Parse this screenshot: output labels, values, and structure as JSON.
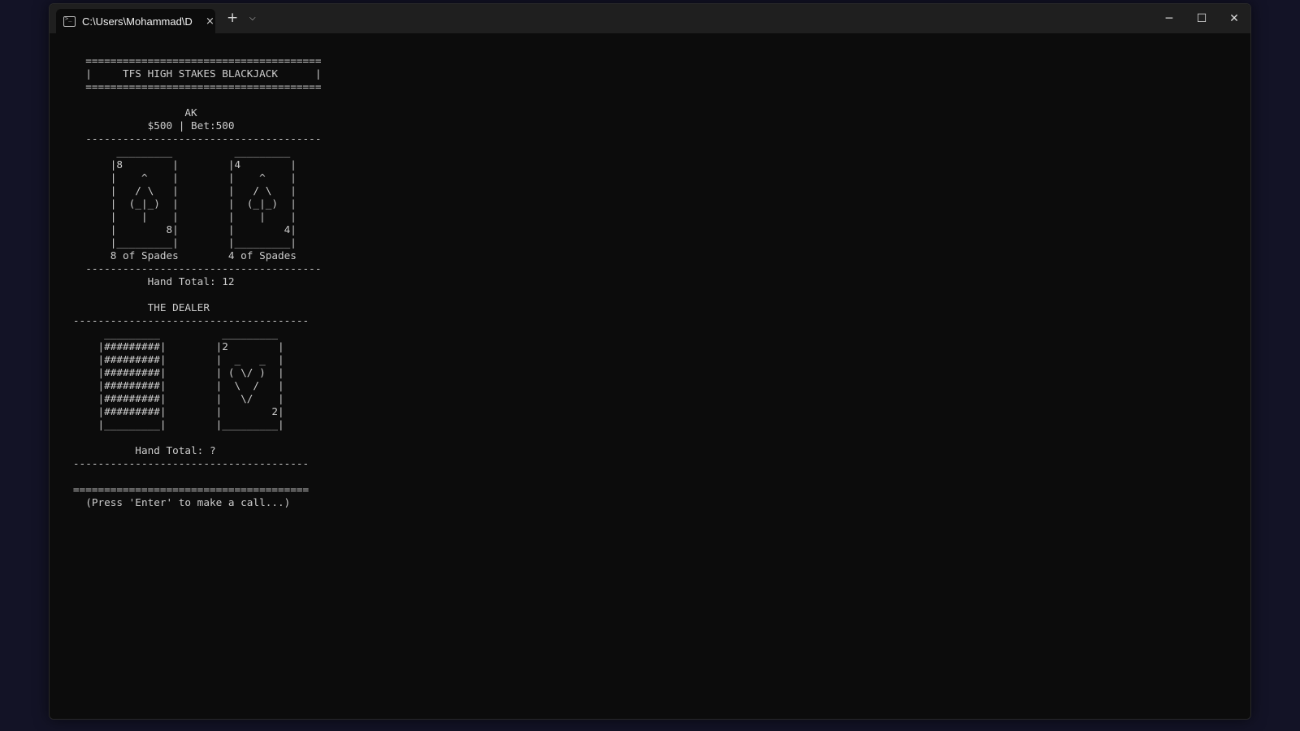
{
  "window": {
    "tab_title": "C:\\Users\\Mohammad\\D",
    "tab_close_icon": "×",
    "new_tab_icon": "+",
    "dropdown_icon": "⌵",
    "minimize_icon": "─",
    "maximize_icon": "☐",
    "close_icon": "✕"
  },
  "terminal": {
    "lines": {
      "l01": "     ======================================",
      "l02": "     |     TFS HIGH STAKES BLACKJACK      |",
      "l03": "     ======================================",
      "l04": "",
      "l05": "                     AK",
      "l06": "               $500 | Bet:500",
      "l07": "     --------------------------------------",
      "l08": "          _________          _________",
      "l09": "         |8        |        |4        |",
      "l10": "         |    ^    |        |    ^    |",
      "l11": "         |   / \\   |        |   / \\   |",
      "l12": "         |  (_|_)  |        |  (_|_)  |",
      "l13": "         |    |    |        |    |    |",
      "l14": "         |        8|        |        4|",
      "l15": "         |_________|        |_________|",
      "l16": "         8 of Spades        4 of Spades",
      "l17": "     --------------------------------------",
      "l18": "               Hand Total: 12",
      "l19": "",
      "l20": "               THE DEALER",
      "l21": "   --------------------------------------",
      "l22": "        _________          _________",
      "l23": "       |#########|        |2        |",
      "l24": "       |#########|        |  _   _  |",
      "l25": "       |#########|        | ( \\/ )  |",
      "l26": "       |#########|        |  \\  /   |",
      "l27": "       |#########|        |   \\/    |",
      "l28": "       |#########|        |        2|",
      "l29": "       |_________|        |_________|",
      "l30": "",
      "l31": "             Hand Total: ?",
      "l32": "   --------------------------------------",
      "l33": "",
      "l34": "   ======================================",
      "l35": "     (Press 'Enter' to make a call...)"
    }
  }
}
